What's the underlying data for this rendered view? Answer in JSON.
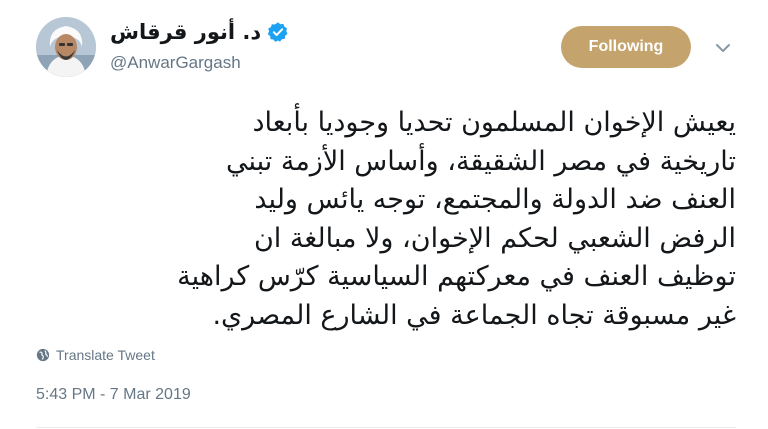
{
  "author": {
    "display_name": "د. أنور قرقاش",
    "handle": "@AnwarGargash",
    "verified": true
  },
  "actions": {
    "follow_label": "Following",
    "more_icon": "chevron-down-icon"
  },
  "tweet": {
    "lines": [
      "يعيش الإخوان المسلمون تحديا وجوديا بأبعاد",
      "تاريخية في مصر الشقيقة، وأساس الأزمة تبني",
      "العنف ضد الدولة والمجتمع، توجه يائس وليد",
      "الرفض الشعبي لحكم الإخوان، ولا مبالغة ان",
      "توظيف العنف في معركتهم السياسية كرّس كراهية",
      "غير مسبوقة تجاه الجماعة في الشارع المصري."
    ],
    "translate_label": "Translate Tweet",
    "timestamp": "5:43 PM - 7 Mar 2019"
  },
  "colors": {
    "follow_button": "#c5a36d",
    "verified": "#1da1f2",
    "secondary_text": "#657786"
  }
}
